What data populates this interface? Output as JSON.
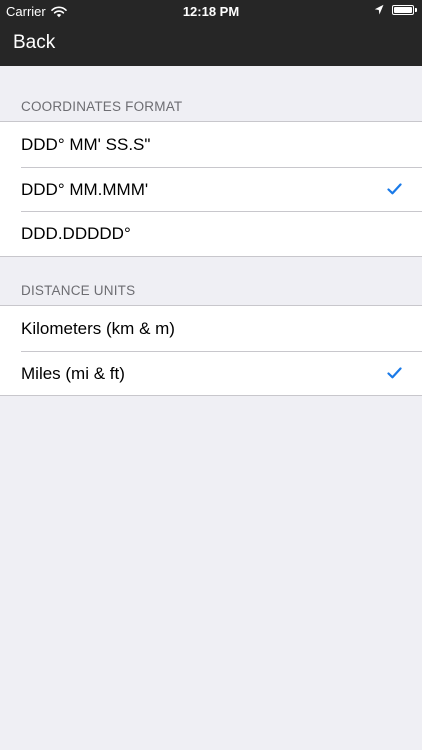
{
  "status_bar": {
    "carrier": "Carrier",
    "time": "12:18 PM",
    "battery_level": 1.0
  },
  "nav": {
    "back_label": "Back"
  },
  "sections": [
    {
      "header": "COORDINATES FORMAT",
      "items": [
        {
          "label": "DDD° MM' SS.S\"",
          "selected": false
        },
        {
          "label": "DDD° MM.MMM'",
          "selected": true
        },
        {
          "label": "DDD.DDDDD°",
          "selected": false
        }
      ]
    },
    {
      "header": "DISTANCE UNITS",
      "items": [
        {
          "label": "Kilometers (km & m)",
          "selected": false
        },
        {
          "label": "Miles (mi & ft)",
          "selected": true
        }
      ]
    }
  ],
  "colors": {
    "accent": "#1a7ae8",
    "background": "#efeff4",
    "navbar": "#262626"
  }
}
